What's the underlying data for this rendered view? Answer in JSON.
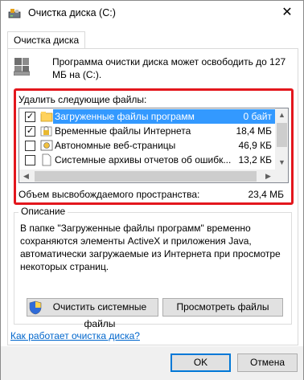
{
  "window": {
    "title": "Очистка диска  (C:)",
    "icon": "disk-cleanup-icon"
  },
  "tabs": [
    {
      "label": "Очистка диска",
      "active": true
    }
  ],
  "summary": {
    "text": "Программа очистки диска может освободить до 127 МБ на  (C:).",
    "icon": "drive-icon"
  },
  "files_section": {
    "label": "Удалить следующие файлы:",
    "items": [
      {
        "checked": true,
        "name": "Загруженные файлы программ",
        "size": "0 байт",
        "selected": true,
        "icon": "folder-icon"
      },
      {
        "checked": true,
        "name": "Временные файлы Интернета",
        "size": "18,4 МБ",
        "selected": false,
        "icon": "lock-folder-icon"
      },
      {
        "checked": false,
        "name": "Автономные веб-страницы",
        "size": "46,9 КБ",
        "selected": false,
        "icon": "offline-pages-icon"
      },
      {
        "checked": false,
        "name": "Системные архивы отчетов об ошибк...",
        "size": "13,2 КБ",
        "selected": false,
        "icon": "file-icon"
      }
    ],
    "freed_label": "Объем высвобождаемого пространства:",
    "freed_value": "23,4 МБ"
  },
  "description": {
    "legend": "Описание",
    "text": "В папке \"Загруженные файлы программ\" временно сохраняются элементы ActiveX и приложения Java, автоматически загружаемые из Интернета при просмотре некоторых страниц."
  },
  "buttons": {
    "clean_system": "Очистить системные файлы",
    "view_files": "Просмотреть файлы",
    "ok": "OK",
    "cancel": "Отмена"
  },
  "help_link": "Как работает очистка диска?",
  "colors": {
    "highlight_frame": "#e3171d",
    "selection": "#3399ff",
    "link": "#0066cc"
  }
}
